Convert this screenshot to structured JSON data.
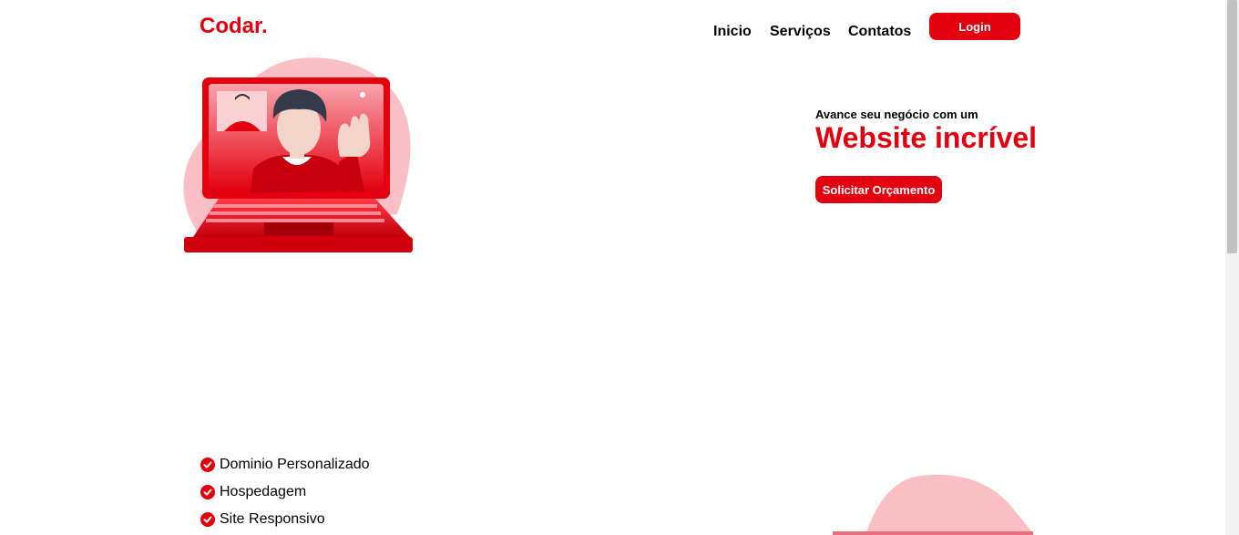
{
  "header": {
    "logo": "Codar.",
    "nav": [
      "Inicio",
      "Serviços",
      "Contatos"
    ],
    "login_label": "Login"
  },
  "hero": {
    "tagline": "Avance seu negócio com um",
    "headline": "Website incrível",
    "cta_label": "Solicitar Orçamento"
  },
  "features": [
    "Dominio Personalizado",
    "Hospedagem",
    "Site Responsivo"
  ],
  "colors": {
    "accent": "#e3000f",
    "blob": "#f9bfc5"
  },
  "icons": {
    "feature": "check-circle-icon"
  }
}
